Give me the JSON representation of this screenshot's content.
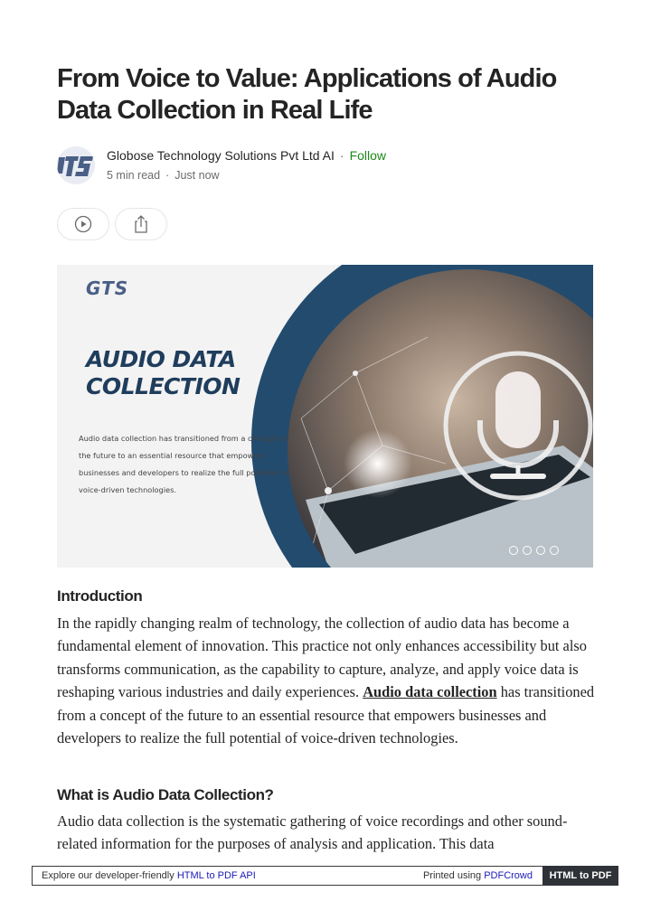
{
  "article": {
    "title": "From Voice to Value: Applications of Audio Data Collection in Real Life",
    "author": {
      "name": "Globose Technology Solutions Pvt Ltd AI",
      "separator": "·",
      "follow_label": "Follow",
      "avatar_icon": "gts-logo-avatar"
    },
    "meta": {
      "read_time": "5 min read",
      "separator": "·",
      "published": "Just now"
    },
    "actions": {
      "listen_icon": "play-circle-icon",
      "share_icon": "share-icon"
    }
  },
  "hero": {
    "logo_text": "GTS",
    "heading_line1": "AUDIO DATA",
    "heading_line2": "COLLECTION",
    "description": "Audio data collection has transitioned from a concept of the future to an essential resource that empowers businesses and developers to realize the full potential of voice-driven technologies.",
    "mic_icon": "microphone-icon",
    "carousel_dots": 4,
    "colors": {
      "navy": "#1f3d5c",
      "logo": "#4a5f86",
      "background": "#f3f3f3"
    }
  },
  "sections": [
    {
      "heading": "Introduction",
      "text_before_link": "In the rapidly changing realm of technology, the collection of audio data has become a fundamental element of innovation. This practice not only enhances accessibility but also transforms communication, as the capability to capture, analyze, and apply voice data is reshaping various industries and daily experiences. ",
      "link_text": "Audio data collection",
      "text_after_link": " has transitioned from a concept of the future to an essential resource that empowers businesses and developers to realize the full potential of voice-driven technologies."
    },
    {
      "heading": "What is Audio Data Collection?",
      "text": "Audio data collection is the systematic gathering of voice recordings and other sound-related information for the purposes of analysis and application. This data"
    }
  ],
  "footer": {
    "left_text": "Explore our developer-friendly ",
    "left_link": "HTML to PDF API",
    "right_text": "Printed using ",
    "right_link": "PDFCrowd",
    "button_label": "HTML to PDF",
    "colors": {
      "link": "#1a1ab8",
      "button_bg": "#2f3237"
    }
  },
  "colors": {
    "follow": "#1a8917",
    "text": "#242424",
    "muted": "#6b6b6b"
  }
}
